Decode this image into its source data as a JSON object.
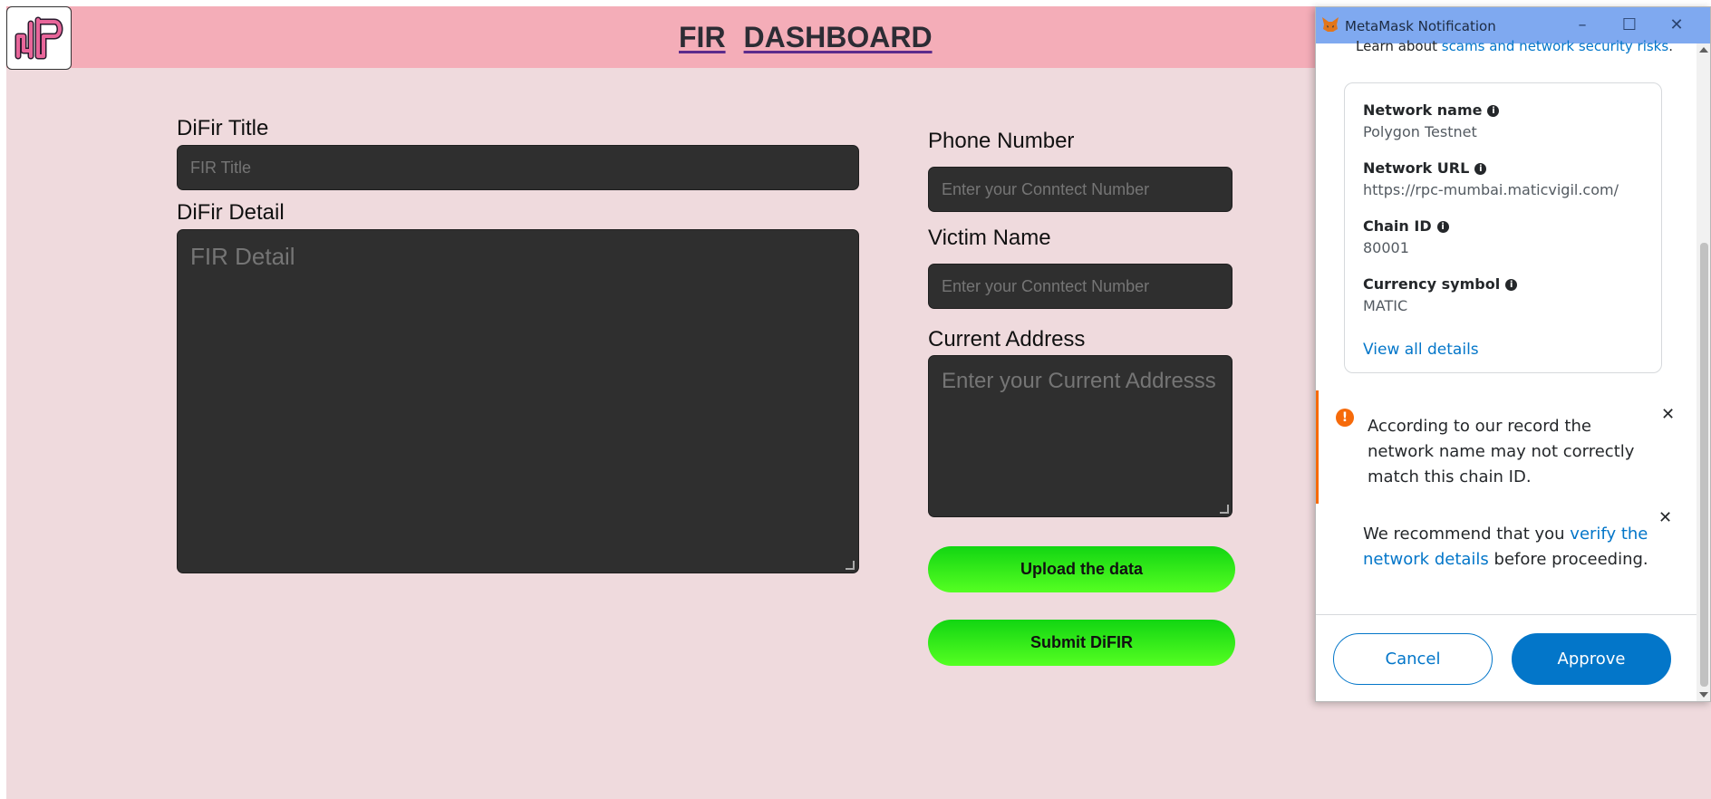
{
  "header": {
    "title_part1": "FIR",
    "title_part2": "DASHBOARD",
    "logo_icon": "dp-logo-icon"
  },
  "form": {
    "title_label": "DiFir Title",
    "title_placeholder": "FIR Title",
    "detail_label": "DiFir Detail",
    "detail_placeholder": "FIR Detail",
    "phone_label": "Phone Number",
    "phone_placeholder": "Enter your Conntect Number",
    "victim_label": "Victim Name",
    "victim_placeholder": "Enter your Conntect Number",
    "address_label": "Current Address",
    "address_placeholder": "Enter your Current Addresss",
    "upload_button": "Upload the data",
    "submit_button": "Submit DiFIR"
  },
  "metamask": {
    "window_title": "MetaMask Notification",
    "scroll_text_prefix": "Learn about ",
    "scroll_text_link": "scams and network security risks",
    "scroll_text_suffix": ".",
    "network_name_label": "Network name",
    "network_name_value": "Polygon Testnet",
    "network_url_label": "Network URL",
    "network_url_value": "https://rpc-mumbai.maticvigil.com/",
    "chain_id_label": "Chain ID",
    "chain_id_value": "80001",
    "currency_label": "Currency symbol",
    "currency_value": "MATIC",
    "view_all": "View all details",
    "warning_text": "According to our record the network name may not correctly match this chain ID.",
    "recommend_prefix": "We recommend that you ",
    "recommend_link": "verify the network details",
    "recommend_suffix": " before proceeding.",
    "cancel_button": "Cancel",
    "approve_button": "Approve",
    "accent_color": "#0376c9",
    "warning_color": "#f66a0a"
  }
}
